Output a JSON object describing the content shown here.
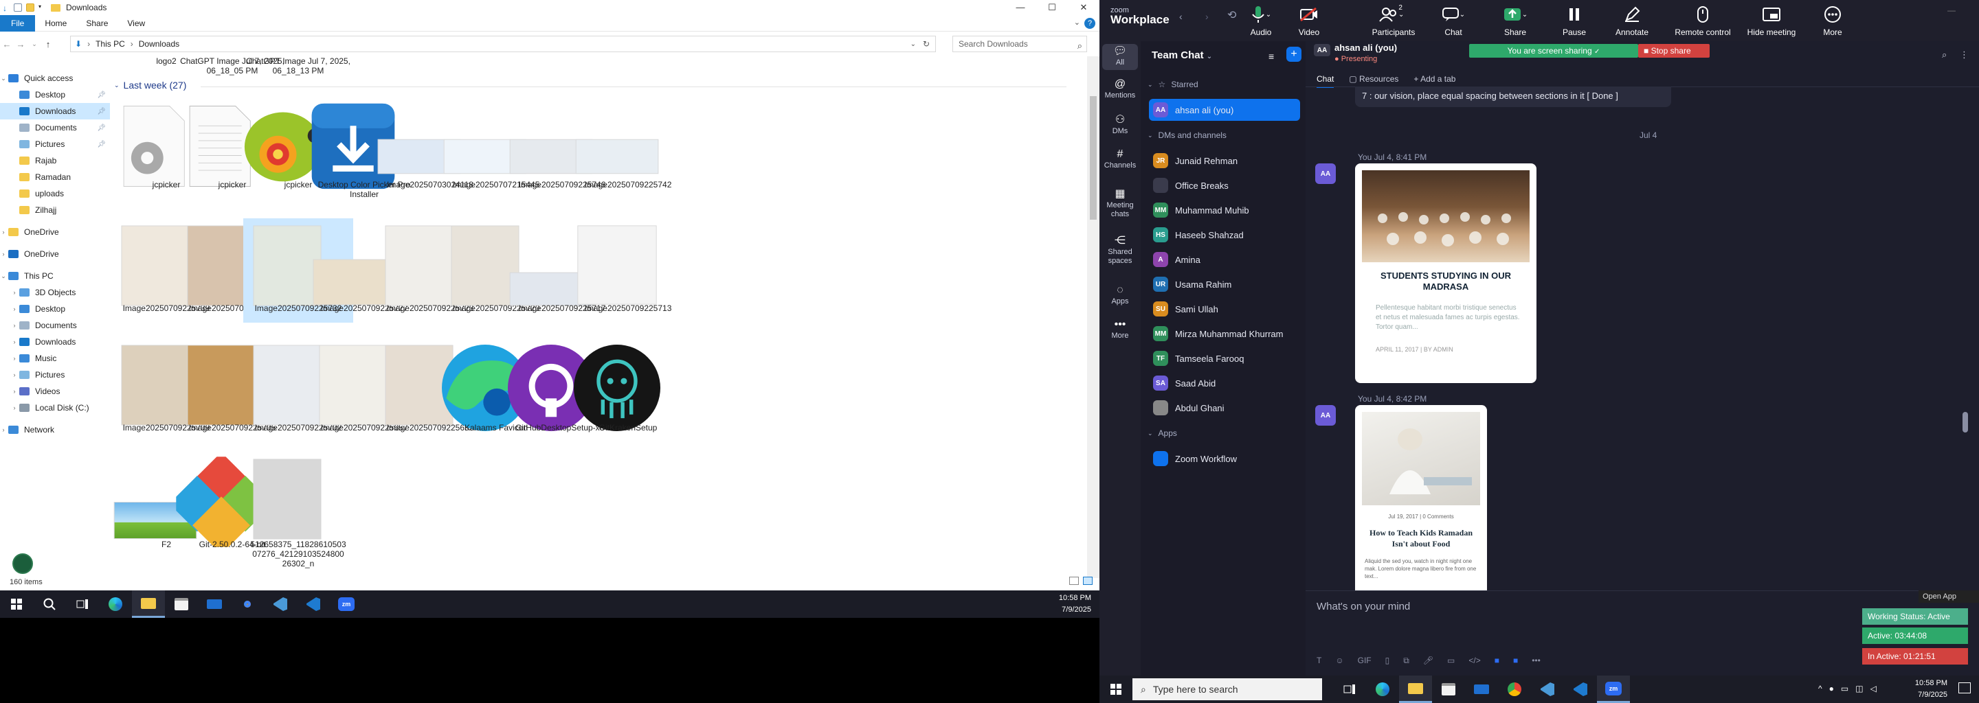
{
  "explorer": {
    "title": "Downloads",
    "window_controls": [
      "—",
      "☐",
      "✕"
    ],
    "ribbon_tabs": [
      "File",
      "Home",
      "Share",
      "View"
    ],
    "address": [
      "This PC",
      "Downloads"
    ],
    "search_placeholder": "Search Downloads",
    "nav": [
      {
        "label": "Quick access",
        "type": "header",
        "icon": "star-icon"
      },
      {
        "label": "Desktop",
        "pinned": true,
        "icon": "desktop-icon"
      },
      {
        "label": "Downloads",
        "pinned": true,
        "selected": true,
        "icon": "downloads-icon"
      },
      {
        "label": "Documents",
        "pinned": true,
        "icon": "documents-icon"
      },
      {
        "label": "Pictures",
        "pinned": true,
        "icon": "pictures-icon"
      },
      {
        "label": "Rajab",
        "icon": "folder-icon"
      },
      {
        "label": "Ramadan",
        "icon": "folder-icon"
      },
      {
        "label": "uploads",
        "icon": "folder-icon"
      },
      {
        "label": "Zilhajj",
        "icon": "folder-icon"
      },
      {
        "label": "OneDrive",
        "icon": "folder-icon"
      },
      {
        "label": "OneDrive",
        "icon": "onedrive-icon"
      },
      {
        "label": "This PC",
        "icon": "pc-icon"
      },
      {
        "label": "3D Objects",
        "icon": "3d-objects-icon"
      },
      {
        "label": "Desktop",
        "icon": "desktop-icon"
      },
      {
        "label": "Documents",
        "icon": "documents-icon"
      },
      {
        "label": "Downloads",
        "icon": "downloads-icon"
      },
      {
        "label": "Music",
        "icon": "music-icon"
      },
      {
        "label": "Pictures",
        "icon": "pictures-icon"
      },
      {
        "label": "Videos",
        "icon": "videos-icon"
      },
      {
        "label": "Local Disk (C:)",
        "icon": "disk-icon"
      },
      {
        "label": "Network",
        "icon": "network-icon"
      }
    ],
    "top_partial": [
      "logo2",
      "ChatGPT Image Jul 7, 2025, 06_18_05 PM",
      "ChatGPT Image Jul 7, 2025, 06_18_13 PM"
    ],
    "group_label": "Last week (27)",
    "items": [
      "jcpicker",
      "jcpicker",
      "jcpicker",
      "Desktop Color Picker Pro Installer",
      "Image20250703024118",
      "Image20250707215445",
      "Image20250709225746",
      "Image20250709225742",
      "Image20250709225739",
      "Image20250709225735",
      "Image20250709225732",
      "Image20250709225727",
      "Image20250709225723",
      "Image20250709225720",
      "Image20250709225717",
      "Image20250709225713",
      "Image20250709225709",
      "Image20250709225705",
      "Image20250709225702",
      "Image20250709225657",
      "Image20250709225653",
      "Kalaams Favicon",
      "GitHubDesktopSetup-x64",
      "GitKrakenSetup",
      "F2",
      "Git-2.50.0.2-64-bit",
      "512658375_1182861050307276_4212910352480026302_n"
    ],
    "status": "160 items"
  },
  "taskbar_left": {
    "time": "10:58 PM",
    "date": "7/9/2025"
  },
  "zoom": {
    "logo_top": "zoom",
    "logo_bottom": "Workplace",
    "toolbar": [
      {
        "label": "Audio",
        "icon": "mic-icon"
      },
      {
        "label": "Video",
        "icon": "video-off-icon"
      },
      {
        "label": "Participants",
        "icon": "participants-icon",
        "count": "2"
      },
      {
        "label": "Chat",
        "icon": "chat-icon"
      },
      {
        "label": "Share",
        "icon": "share-icon"
      },
      {
        "label": "Pause",
        "icon": "pause-icon"
      },
      {
        "label": "Annotate",
        "icon": "annotate-icon"
      },
      {
        "label": "Remote control",
        "icon": "remote-control-icon"
      },
      {
        "label": "Hide meeting",
        "icon": "hide-meeting-icon"
      },
      {
        "label": "More",
        "icon": "more-icon"
      }
    ],
    "sharing_text": "You are screen sharing",
    "stop_share": "Stop share",
    "rail": [
      {
        "label": "All",
        "icon": "chat-bubble-icon",
        "selected": true
      },
      {
        "label": "Mentions",
        "icon": "at-icon"
      },
      {
        "label": "DMs",
        "icon": "people-icon"
      },
      {
        "label": "Channels",
        "icon": "hash-icon"
      },
      {
        "label": "Meeting chats",
        "icon": "calendar-icon"
      },
      {
        "label": "Shared spaces",
        "icon": "share-nodes-icon"
      },
      {
        "label": "Apps",
        "icon": "apps-icon"
      },
      {
        "label": "More",
        "icon": "more-dots-icon"
      }
    ],
    "team_chat_title": "Team Chat",
    "starred_label": "Starred",
    "dms_label": "DMs and channels",
    "apps_label": "Apps",
    "starred": [
      {
        "name": "ahsan ali (you)",
        "initials": "AA",
        "color": "#6b5bd6"
      }
    ],
    "contacts": [
      {
        "name": "Junaid Rehman",
        "initials": "JR",
        "color": "#d98c1f"
      },
      {
        "name": "Office Breaks",
        "initials": "",
        "color": "#3a3b4c"
      },
      {
        "name": "Muhammad Muhib",
        "initials": "MM",
        "color": "#2f8f5b"
      },
      {
        "name": "Haseeb Shahzad",
        "initials": "HS",
        "color": "#2a9d8f"
      },
      {
        "name": "Amina",
        "initials": "A",
        "color": "#8e44ad"
      },
      {
        "name": "Usama Rahim",
        "initials": "UR",
        "color": "#1f6fb2"
      },
      {
        "name": "Sami Ullah",
        "initials": "SU",
        "color": "#d98c1f"
      },
      {
        "name": "Mirza Muhammad Khurram",
        "initials": "MM",
        "color": "#2f8f5b"
      },
      {
        "name": "Tamseela Farooq",
        "initials": "TF",
        "color": "#2f8f5b"
      },
      {
        "name": "Saad Abid",
        "initials": "SA",
        "color": "#6b5bd6"
      },
      {
        "name": "Abdul Ghani",
        "initials": "",
        "color": "#888"
      }
    ],
    "apps": [
      {
        "name": "Zoom Workflow",
        "initials": "",
        "color": "#0e72ed"
      }
    ],
    "chat_header_name": "ahsan ali (you)",
    "chat_header_status": "Presenting",
    "tabs": [
      "Chat",
      "Resources",
      "+ Add a tab"
    ],
    "prev_message": "7 : our vision, place equal spacing between sections in it  [ Done ]",
    "date_divider": "Jul 4",
    "msg1_time": "You Jul 4, 8:41 PM",
    "card1": {
      "title": "STUDENTS STUDYING IN OUR MADRASA",
      "body": "Pellentesque habitant morbi tristique senectus et netus et malesuada fames ac turpis egestas. Tortor quam...",
      "meta": "APRIL 11, 2017   |   BY ADMIN"
    },
    "msg2_time": "You Jul 4, 8:42 PM",
    "card2": {
      "meta": "Jul 19, 2017   |   0 Comments",
      "title": "How to Teach Kids Ramadan Isn't about Food",
      "body": "Aliquid the sed you, watch in night night one mak. Lorem dolore magna libero fire from one text..."
    },
    "composer_placeholder": "What's on your mind",
    "open_app": "Open App",
    "working_status": "Working Status: Active",
    "active_time": "Active: 03:44:08",
    "inactive_time": "In Active: 01:21:51",
    "colors": {
      "active": "#2ea96b",
      "inactive": "#d2423f",
      "status": "#4caf8b"
    }
  },
  "taskbar_right": {
    "search_placeholder": "Type here to search",
    "time": "10:58 PM",
    "date": "7/9/2025"
  }
}
